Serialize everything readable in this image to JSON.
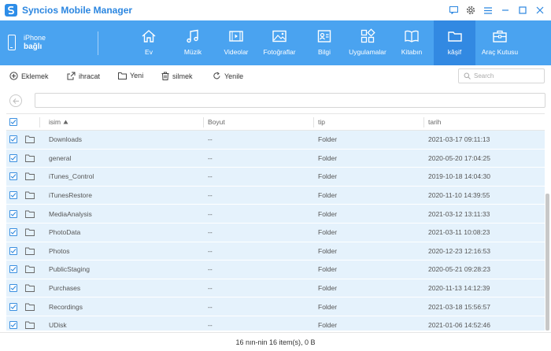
{
  "app": {
    "title": "Syncios Mobile Manager"
  },
  "device": {
    "name": "iPhone",
    "status": "bağlı"
  },
  "nav": {
    "items": [
      {
        "label": "Ev",
        "icon": "home-icon"
      },
      {
        "label": "Müzik",
        "icon": "music-icon"
      },
      {
        "label": "Videolar",
        "icon": "video-icon"
      },
      {
        "label": "Fotoğraflar",
        "icon": "photo-icon"
      },
      {
        "label": "Bilgi",
        "icon": "contact-card-icon"
      },
      {
        "label": "Uygulamalar",
        "icon": "apps-icon"
      },
      {
        "label": "Kitabın",
        "icon": "book-icon"
      },
      {
        "label": "kâşif",
        "icon": "folder-icon",
        "active": true
      },
      {
        "label": "Araç Kutusu",
        "icon": "toolbox-icon"
      }
    ]
  },
  "toolbar": {
    "add_label": "Eklemek",
    "export_label": "ihracat",
    "new_label": "Yeni",
    "delete_label": "silmek",
    "refresh_label": "Yenile",
    "search_placeholder": "Search"
  },
  "table": {
    "headers": {
      "name": "isim",
      "size": "Boyut",
      "type": "tip",
      "date": "tarih"
    },
    "rows": [
      {
        "name": "Downloads",
        "size": "--",
        "type": "Folder",
        "date": "2021-03-17 09:11:13"
      },
      {
        "name": "general",
        "size": "--",
        "type": "Folder",
        "date": "2020-05-20 17:04:25"
      },
      {
        "name": "iTunes_Control",
        "size": "--",
        "type": "Folder",
        "date": "2019-10-18 14:04:30"
      },
      {
        "name": "iTunesRestore",
        "size": "--",
        "type": "Folder",
        "date": "2020-11-10 14:39:55"
      },
      {
        "name": "MediaAnalysis",
        "size": "--",
        "type": "Folder",
        "date": "2021-03-12 13:11:33"
      },
      {
        "name": "PhotoData",
        "size": "--",
        "type": "Folder",
        "date": "2021-03-11 10:08:23"
      },
      {
        "name": "Photos",
        "size": "--",
        "type": "Folder",
        "date": "2020-12-23 12:16:53"
      },
      {
        "name": "PublicStaging",
        "size": "--",
        "type": "Folder",
        "date": "2020-05-21 09:28:23"
      },
      {
        "name": "Purchases",
        "size": "--",
        "type": "Folder",
        "date": "2020-11-13 14:12:39"
      },
      {
        "name": "Recordings",
        "size": "--",
        "type": "Folder",
        "date": "2021-03-18 15:56:57"
      },
      {
        "name": "UDisk",
        "size": "--",
        "type": "Folder",
        "date": "2021-01-06 14:52:46"
      }
    ]
  },
  "status": {
    "text": "16 nın-nin 16 item(s), 0 B"
  },
  "colors": {
    "accent": "#4aa3f0",
    "accent_active": "#3289e2",
    "row_selected": "#e5f2fc",
    "title": "#2b86e0"
  }
}
